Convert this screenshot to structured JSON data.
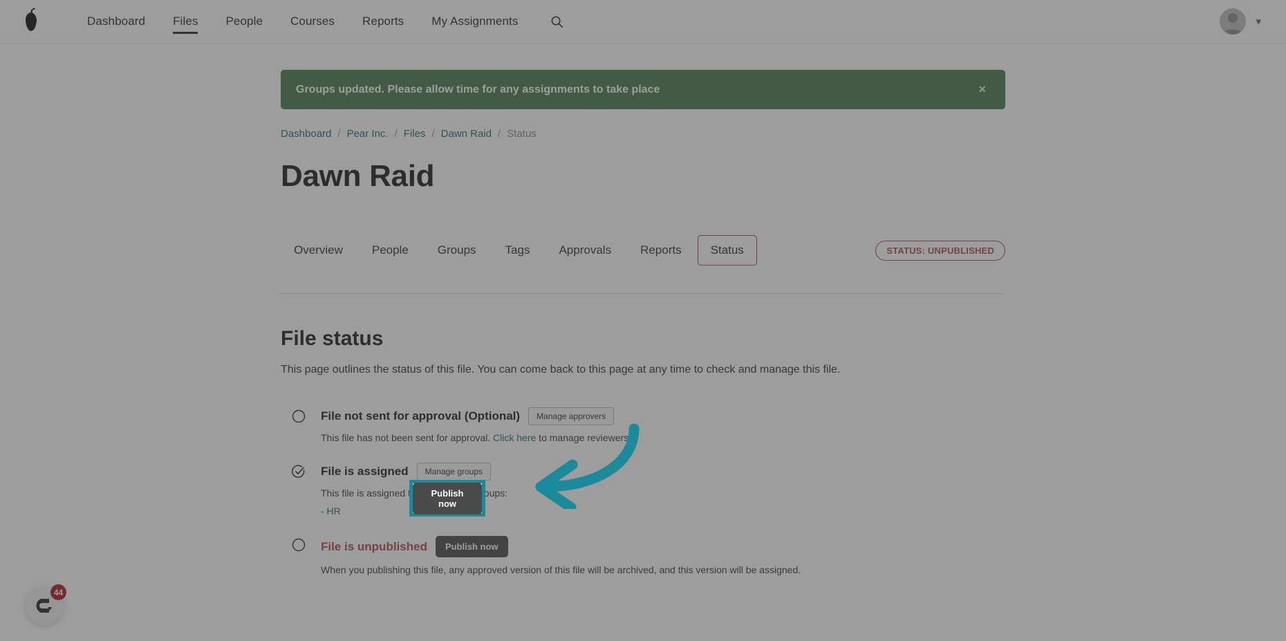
{
  "nav": {
    "logo_icon": "pear-logo-icon",
    "items": [
      {
        "label": "Dashboard",
        "active": false
      },
      {
        "label": "Files",
        "active": true
      },
      {
        "label": "People",
        "active": false
      },
      {
        "label": "Courses",
        "active": false
      },
      {
        "label": "Reports",
        "active": false
      },
      {
        "label": "My Assignments",
        "active": false
      }
    ],
    "search_icon": "search-icon",
    "avatar_icon": "user-avatar-icon",
    "chevron": "⌄"
  },
  "alert": {
    "message": "Groups updated. Please allow time for any assignments to take place",
    "close_label": "×",
    "color": "#4b7a4e"
  },
  "breadcrumb": {
    "items": [
      "Dashboard",
      "Pear Inc.",
      "Files",
      "Dawn Raid",
      "Status"
    ],
    "separator": "/"
  },
  "page": {
    "title": "Dawn Raid"
  },
  "tabs": {
    "items": [
      {
        "label": "Overview",
        "active": false
      },
      {
        "label": "People",
        "active": false
      },
      {
        "label": "Groups",
        "active": false
      },
      {
        "label": "Tags",
        "active": false
      },
      {
        "label": "Approvals",
        "active": false
      },
      {
        "label": "Reports",
        "active": false
      },
      {
        "label": "Status",
        "active": true
      }
    ],
    "status_badge": "STATUS: UNPUBLISHED",
    "status_color": "#b04a4a"
  },
  "section": {
    "title": "File status",
    "description": "This page outlines the status of this file. You can come back to this page at any time to check and manage this file."
  },
  "steps": [
    {
      "icon": "circle-empty-icon",
      "title": "File not sent for approval (Optional)",
      "button": "Manage approvers",
      "desc_before": "This file has not been sent for approval. ",
      "link": "Click here",
      "desc_after": " to manage reviewers.",
      "danger": false
    },
    {
      "icon": "circle-check-icon",
      "title": "File is assigned",
      "button": "Manage groups",
      "desc_before": "This file is assigned to the following groups:",
      "group": "- HR",
      "danger": false
    },
    {
      "icon": "circle-empty-icon",
      "title": "File is unpublished",
      "button": "Publish now",
      "desc_before": "When you publishing this file, any approved version of this file will be archived, and this version will be assigned.",
      "danger": true
    }
  ],
  "widget": {
    "icon": "chat-widget-icon",
    "badge_count": "44",
    "badge_color": "#b01b1b"
  },
  "annotation": {
    "arrow_color": "#1b8a9c",
    "highlight_border": "#1b8a9c",
    "highlighted_button": "Publish now"
  }
}
